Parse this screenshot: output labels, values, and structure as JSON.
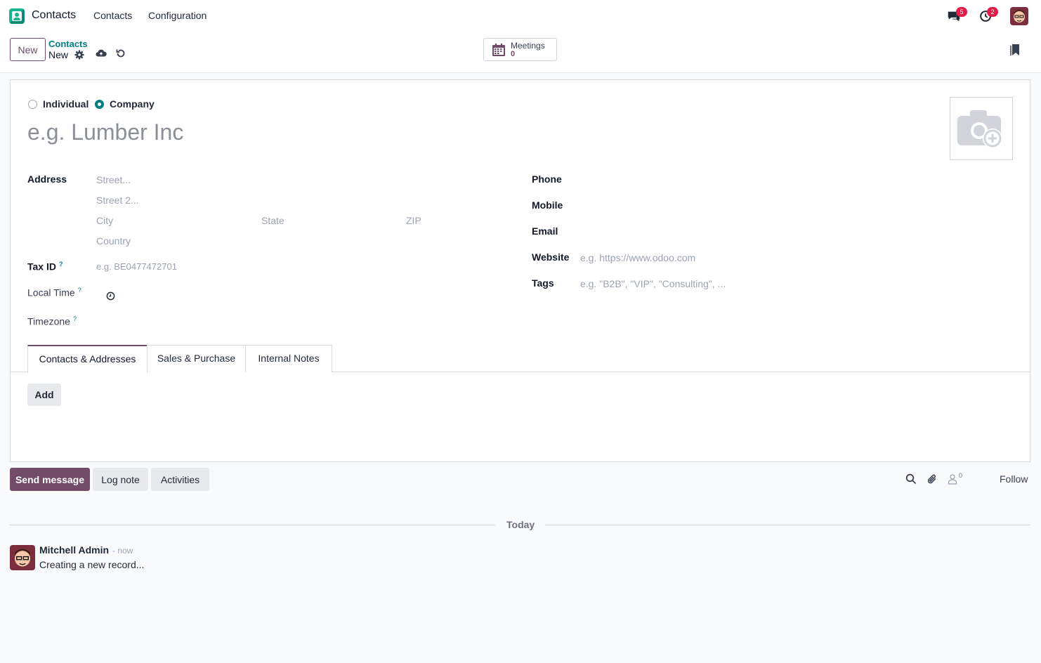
{
  "navbar": {
    "app_name": "Contacts",
    "menu": [
      "Contacts",
      "Configuration"
    ],
    "messages_badge": "5",
    "activities_badge": "2"
  },
  "control_panel": {
    "new_label": "New",
    "breadcrumb_parent": "Contacts",
    "breadcrumb_current": "New",
    "meetings_label": "Meetings",
    "meetings_count": "0"
  },
  "form": {
    "type_options": [
      {
        "label": "Individual",
        "checked": false
      },
      {
        "label": "Company",
        "checked": true
      }
    ],
    "name_placeholder": "e.g. Lumber Inc",
    "address_label": "Address",
    "street_placeholder": "Street...",
    "street2_placeholder": "Street 2...",
    "city_placeholder": "City",
    "state_placeholder": "State",
    "zip_placeholder": "ZIP",
    "country_placeholder": "Country",
    "tax_id_label": "Tax ID",
    "tax_id_placeholder": "e.g. BE0477472701",
    "local_time_label": "Local Time",
    "timezone_label": "Timezone",
    "help_mark": "?",
    "phone_label": "Phone",
    "mobile_label": "Mobile",
    "email_label": "Email",
    "website_label": "Website",
    "website_placeholder": "e.g. https://www.odoo.com",
    "tags_label": "Tags",
    "tags_placeholder": "e.g. \"B2B\", \"VIP\", \"Consulting\", ..."
  },
  "tabs": [
    {
      "label": "Contacts & Addresses",
      "active": true
    },
    {
      "label": "Sales & Purchase",
      "active": false
    },
    {
      "label": "Internal Notes",
      "active": false
    }
  ],
  "add_label": "Add",
  "chatter": {
    "send_message": "Send message",
    "log_note": "Log note",
    "activities": "Activities",
    "follower_count": "0",
    "follow": "Follow",
    "today": "Today",
    "message": {
      "author": "Mitchell Admin",
      "time": "- now",
      "body": "Creating a new record..."
    }
  },
  "colors": {
    "brand": "#714b67",
    "accent": "#017e84",
    "badge": "#e11d48"
  }
}
